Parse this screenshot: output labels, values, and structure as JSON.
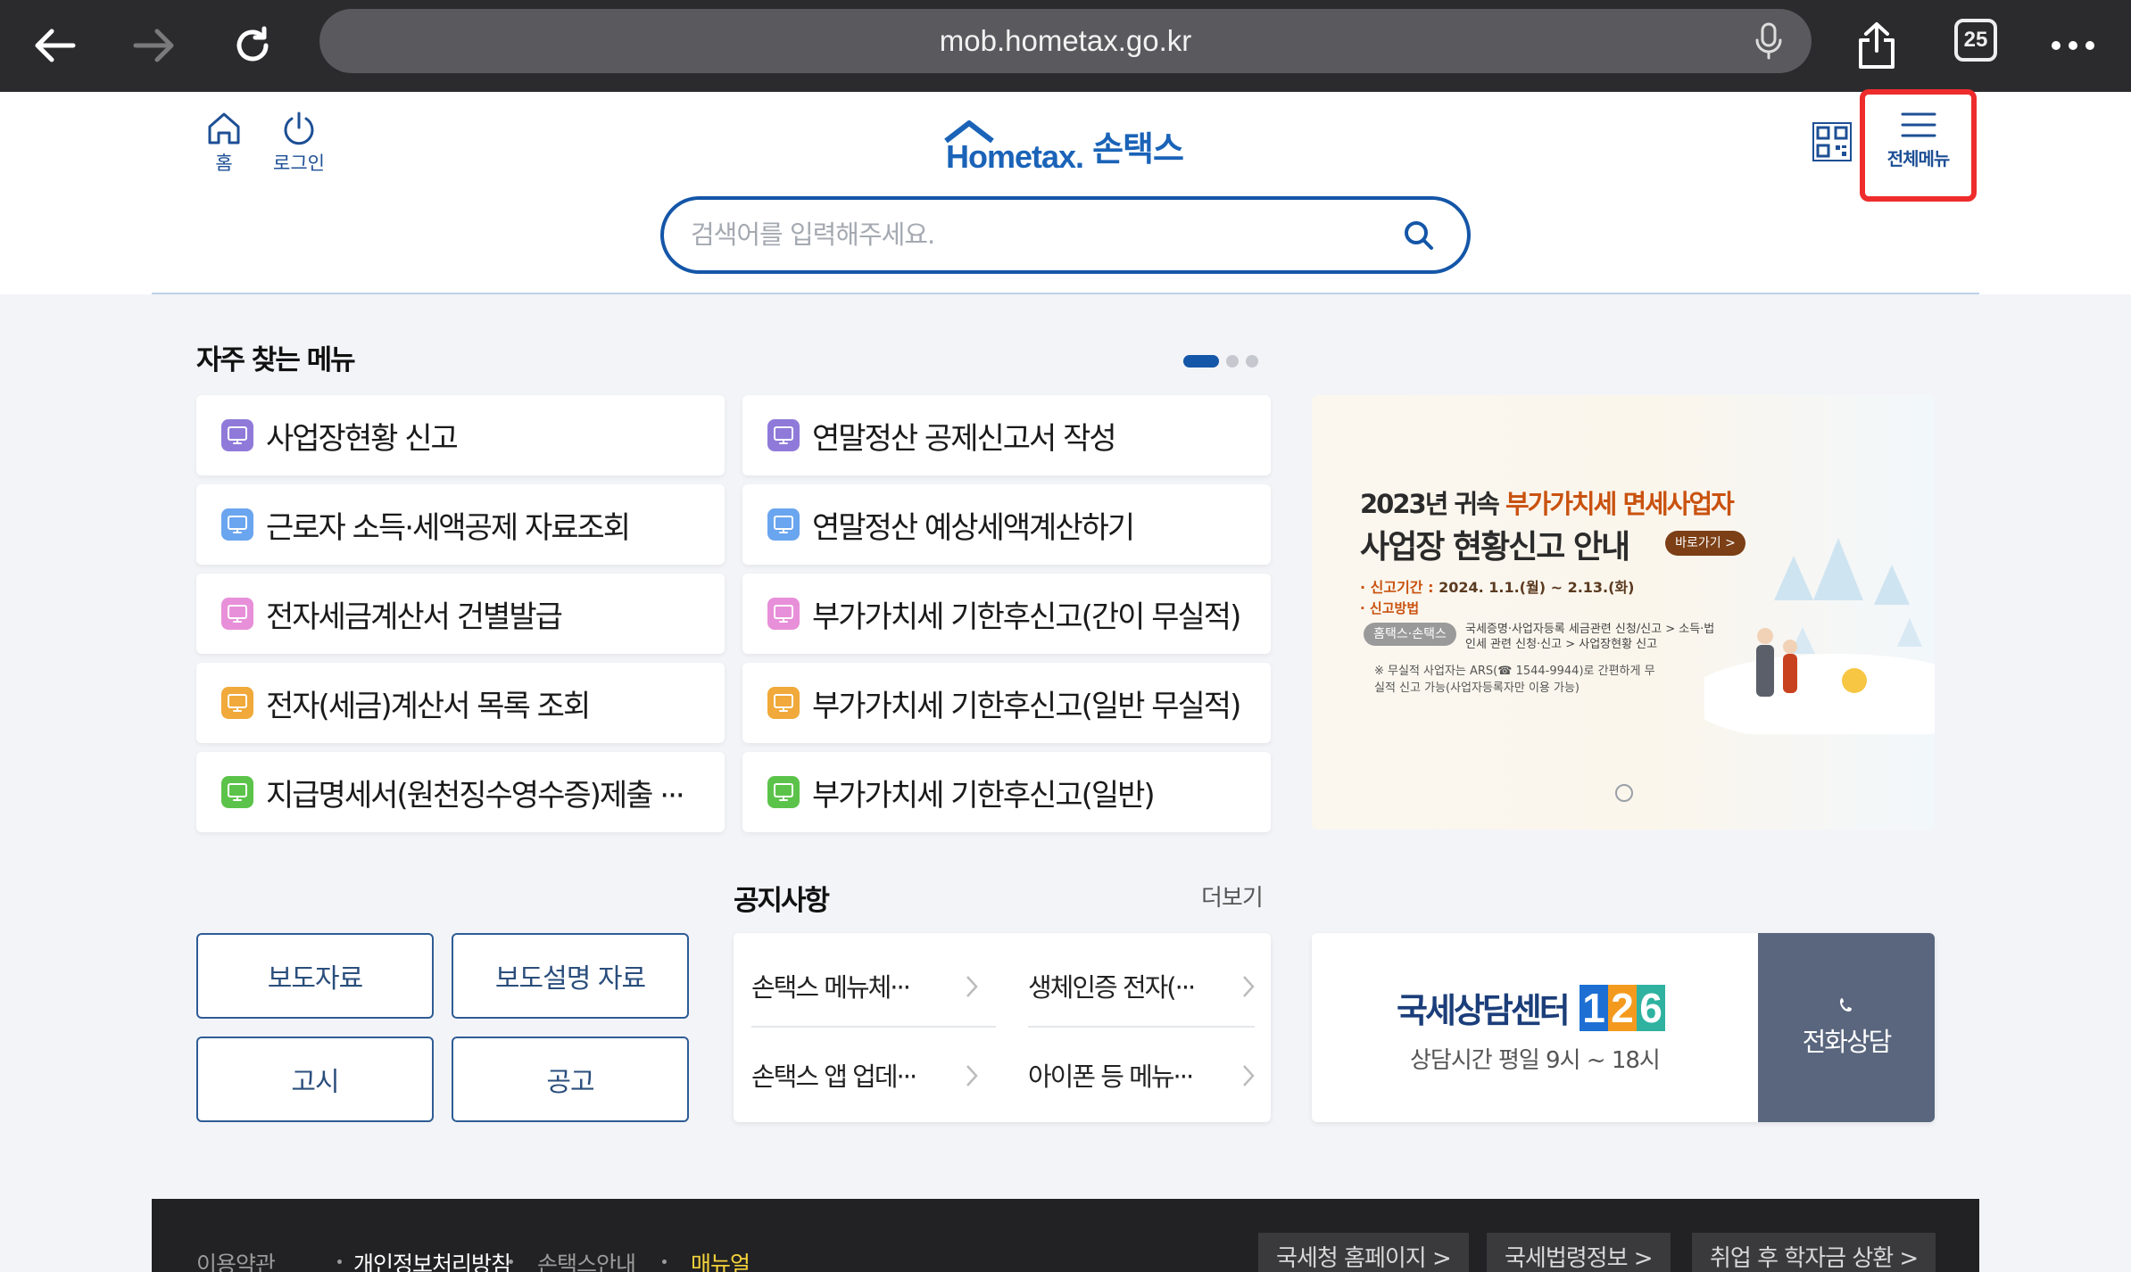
{
  "browser": {
    "url": "mob.hometax.go.kr",
    "tab_count": "25"
  },
  "header": {
    "home_label": "홈",
    "login_label": "로그인",
    "logo_text": "Hometax.",
    "logo_korean": "손택스",
    "search_placeholder": "검색어를 입력해주세요.",
    "all_menu_label": "전체메뉴"
  },
  "frequent": {
    "title": "자주 찾는 메뉴",
    "items": [
      {
        "label": "사업장현황 신고",
        "color": "#8f7ad9"
      },
      {
        "label": "연말정산 공제신고서 작성",
        "color": "#8f7ad9"
      },
      {
        "label": "근로자 소득·세액공제 자료조회",
        "color": "#6aa5ef"
      },
      {
        "label": "연말정산 예상세액계산하기",
        "color": "#6aa5ef"
      },
      {
        "label": "전자세금계산서 건별발급",
        "color": "#e88fd9"
      },
      {
        "label": "부가가치세 기한후신고(간이 무실적)",
        "color": "#e88fd9"
      },
      {
        "label": "전자(세금)계산서 목록 조회",
        "color": "#f0a93a"
      },
      {
        "label": "부가가치세 기한후신고(일반 무실적)",
        "color": "#f0a93a"
      },
      {
        "label": "지급명세서(원천징수영수증)제출 ···",
        "color": "#5cc34a"
      },
      {
        "label": "부가가치세 기한후신고(일반)",
        "color": "#5cc34a"
      }
    ]
  },
  "banner": {
    "line1_a": "2023년 귀속 ",
    "line1_b": "부가가치세 면세사업자",
    "line2": "사업장 현황신고 안내",
    "go_label": "바로가기 >",
    "period_label": "· 신고기간 : ",
    "period_value": "2024. 1.1.(월) ~ 2.13.(화)",
    "method_label": "· 신고방법",
    "pill": "홈택스·손택스",
    "method_text": "국세증명·사업자등록 세금관련 신청/신고 > 소득·법인세 관련 신청·신고 > 사업장현황 신고",
    "note": "※ 무실적 사업자는 ARS(☎ 1544-9944)로 간편하게 무실적 신고 가능(사업자등록자만 이용 가능)"
  },
  "quick": {
    "press": "보도자료",
    "press_explain": "보도설명 자료",
    "notice_gosi": "고시",
    "notice_gonggo": "공고"
  },
  "notices": {
    "title": "공지사항",
    "more": "더보기",
    "items": [
      "손택스 메뉴체···",
      "생체인증 전자(···",
      "손택스 앱 업데···",
      "아이폰 등 메뉴···"
    ]
  },
  "callcenter": {
    "title": "국세상담센터",
    "number": [
      "1",
      "2",
      "6"
    ],
    "number_colors": [
      "#1d6fd3",
      "#f39a1e",
      "#2fb2a0"
    ],
    "hours": "상담시간 평일 9시 ~ 18시",
    "phone_label": "전화상담"
  },
  "footer": {
    "links": [
      "이용약관",
      "개인정보처리방침",
      "손택스안내",
      "매뉴얼"
    ],
    "buttons": [
      "국세청 홈페이지 >",
      "국세법령정보 >",
      "취업 후 학자금 상환 >"
    ]
  }
}
